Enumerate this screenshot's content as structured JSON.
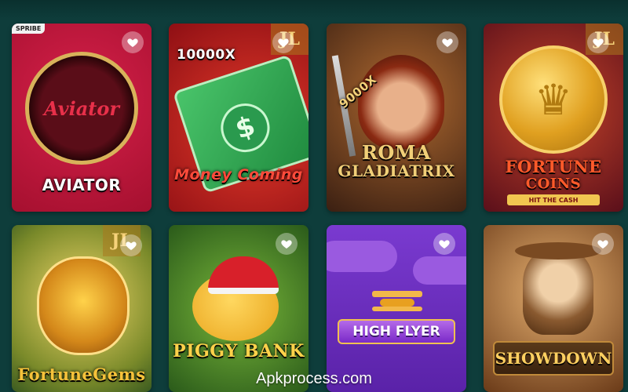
{
  "games": [
    {
      "id": "aviator",
      "title": "AVIATOR",
      "logo_text": "Aviator",
      "corner_tag": "SPRIBE",
      "bg": "#c0173e"
    },
    {
      "id": "money-coming",
      "title": "Money Coming",
      "multiplier": "10000X",
      "badge": "JL",
      "bg": "#b8161e"
    },
    {
      "id": "roma-gladiatrix",
      "title_line1": "ROMA",
      "title_line2": "GLADIATRIX",
      "multiplier": "9000X",
      "bg": "#5a3a26"
    },
    {
      "id": "fortune-coins",
      "title_line1": "FORTUNE",
      "title_line2": "COINS",
      "subtitle": "HIT THE CASH",
      "badge": "JL",
      "bg": "#9a1e34"
    },
    {
      "id": "fortune-gems",
      "title": "FortuneGems",
      "badge": "JL",
      "bg": "#7a8a2a"
    },
    {
      "id": "piggy-bank",
      "title": "PIGGY BANK",
      "bg": "#3f7a2a"
    },
    {
      "id": "high-flyer",
      "title": "HIGH FLYER",
      "bg": "#6a2fb8"
    },
    {
      "id": "showdown",
      "title": "SHOWDOWN",
      "bg": "#8a5a2a"
    }
  ],
  "watermark": "Apkprocess.com",
  "colors": {
    "page_bg": "#0e3d3b",
    "heart": "#ffffff",
    "gold": "#f4c430"
  }
}
